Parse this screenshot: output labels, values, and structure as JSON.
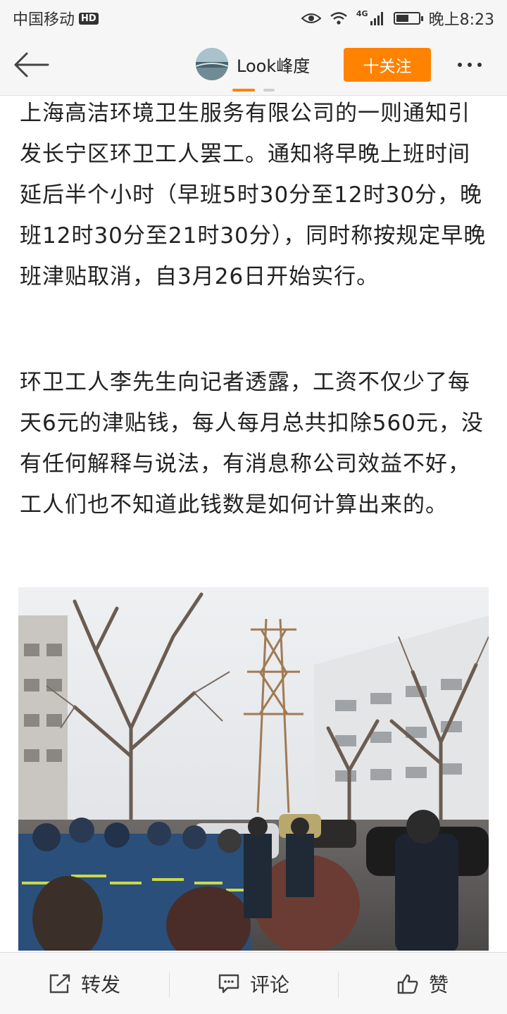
{
  "status_bar": {
    "carrier": "中国移动",
    "hd": "HD",
    "network": "4G",
    "time": "晚上8:23",
    "battery_level": 0.55
  },
  "header": {
    "back_icon": "back-arrow-icon",
    "profile_name": "Look峰度",
    "follow_label": "十关注",
    "more_icon": "more-dots-icon",
    "accent_color": "#ff8200"
  },
  "article": {
    "paragraphs": [
      "上海高洁环境卫生服务有限公司的一则通知引发长宁区环卫工人罢工。通知将早晚上班时间延后半个小时（早班5时30分至12时30分，晚班12时30分至21时30分），同时称按规定早晚班津贴取消，自3月26日开始实行。",
      "环卫工人李先生向记者透露，工资不仅少了每天6元的津贴钱，每人每月总共扣除560元，没有任何解释与说法，有消息称公司效益不好，工人们也不知道此钱数是如何计算出来的。"
    ]
  },
  "toolbar": {
    "repost_label": "转发",
    "comment_label": "评论",
    "like_label": "赞"
  }
}
